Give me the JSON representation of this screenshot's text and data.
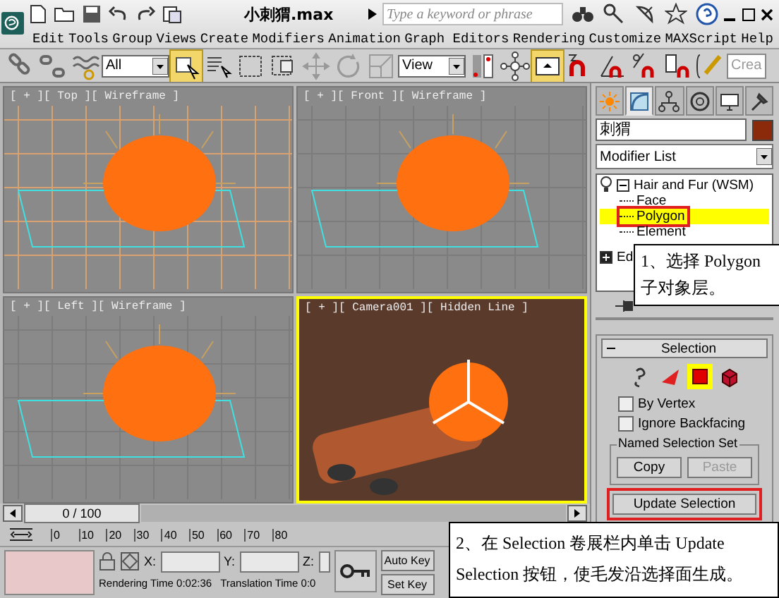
{
  "app": {
    "title": "小刺猬.max",
    "search": {
      "placeholder": "Type a keyword or phrase"
    }
  },
  "menu": [
    "Edit",
    "Tools",
    "Group",
    "Views",
    "Create",
    "Modifiers",
    "Animation",
    "Graph Editors",
    "Rendering",
    "Customize",
    "MAXScript",
    "Help"
  ],
  "toolbar": {
    "selection_filter": "All",
    "reference_coordinate": "View",
    "named_selection": "Crea"
  },
  "viewports": [
    {
      "label": "[ + ][ Top ][ Wireframe ]",
      "kind": "wireframe",
      "selected": false
    },
    {
      "label": "[ + ][ Front ][ Wireframe ]",
      "kind": "wireframe",
      "selected": false
    },
    {
      "label": "[ + ][ Left ][ Wireframe ]",
      "kind": "wireframe",
      "selected": false
    },
    {
      "label": "[ + ][ Camera001 ][ Hidden Line ]",
      "kind": "camera",
      "selected": true
    }
  ],
  "command_panel": {
    "tabs": [
      {
        "selected": false
      },
      {
        "selected": true
      },
      {
        "selected": false
      },
      {
        "selected": false
      },
      {
        "selected": false
      },
      {
        "selected": false
      }
    ],
    "object_name": "刺猬",
    "modifier_list": "Modifier List",
    "stack": [
      {
        "label": "Hair and Fur (WSM)",
        "expanded": true,
        "children": [
          {
            "label": "Face",
            "selected": false,
            "highlighted": false
          },
          {
            "label": "Polygon",
            "selected": true,
            "highlighted": true
          },
          {
            "label": "Element",
            "selected": false,
            "highlighted": false
          }
        ]
      },
      {
        "label": "Ed",
        "expanded": false
      }
    ],
    "rollout": {
      "title": "Selection",
      "expanded": true,
      "levels": [
        {
          "selected": false
        },
        {
          "selected": false
        },
        {
          "selected": true
        },
        {
          "selected": false
        }
      ],
      "checkboxes": [
        {
          "label": "By Vertex",
          "checked": false
        },
        {
          "label": "Ignore Backfacing",
          "checked": false
        }
      ],
      "group": {
        "title": "Named Selection Set",
        "buttons": [
          {
            "label": "Copy",
            "disabled": false
          },
          {
            "label": "Paste",
            "disabled": true
          }
        ]
      },
      "update_button": {
        "label": "Update Selection",
        "highlighted": true
      }
    }
  },
  "timeline": {
    "frame": "0 / 100",
    "ticks": [
      "0",
      "10",
      "20",
      "30",
      "40",
      "50",
      "60",
      "70",
      "80"
    ]
  },
  "status": {
    "x_label": "X:",
    "y_label": "Y:",
    "z_label": "Z:",
    "auto_key": "Auto Key",
    "set_key": "Set Key",
    "rendering_time": "Rendering Time  0:02:36",
    "translation_time": "Translation Time  0:0"
  },
  "callouts": [
    {
      "text": "1、选择 Polygon 子对象层。"
    },
    {
      "text": "2、在 Selection 卷展栏内单击 Update Selection 按钮，使毛发沿选择面生成。"
    }
  ]
}
